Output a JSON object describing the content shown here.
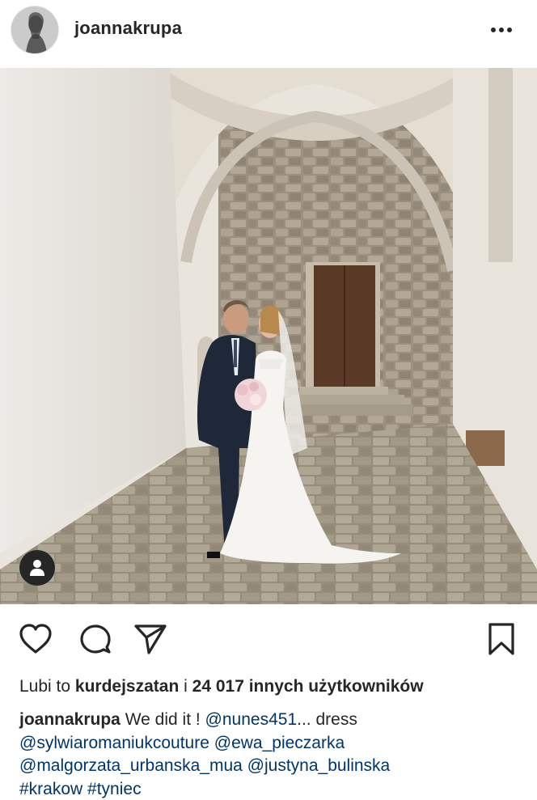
{
  "header": {
    "username": "joannakrupa",
    "more_icon": "more-horizontal-icon"
  },
  "photo": {
    "tag_icon": "person-icon"
  },
  "actions": {
    "like_icon": "heart-icon",
    "comment_icon": "comment-icon",
    "share_icon": "send-icon",
    "save_icon": "bookmark-icon"
  },
  "likes": {
    "prefix": "Lubi to",
    "user": "kurdejszatan",
    "middle": "i",
    "count_text": "24 017 innych użytkowników"
  },
  "caption": {
    "username": "joannakrupa",
    "text": "We did it !",
    "mention_1": "@nunes451",
    "ellipsis_text": "... dress",
    "mention_2": "@sylwiaromaniukcouture",
    "mention_3": "@ewa_pieczarka",
    "mention_4": "@malgorzata_urbanska_mua",
    "mention_5": "@justyna_bulinska",
    "hashtag_1": "#krakow",
    "hashtag_2": "#tyniec"
  },
  "colors": {
    "text": "#262626",
    "link": "#003569",
    "background": "#ffffff"
  }
}
